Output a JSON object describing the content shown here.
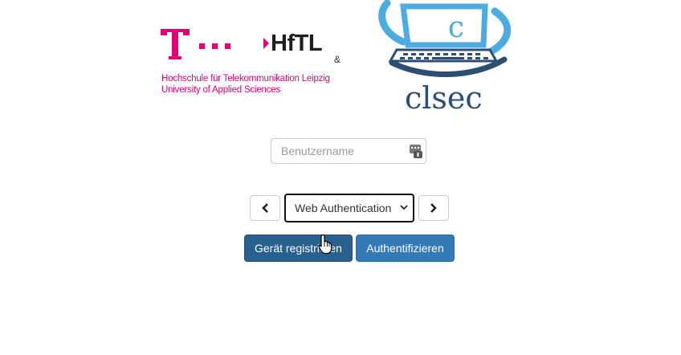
{
  "logos": {
    "hftl": {
      "name": "HfTL",
      "line1": "Hochschule für Telekommunikation Leipzig",
      "line2": "University of Applied Sciences"
    },
    "ampersand": "&",
    "clsec": {
      "letter": "c",
      "name": "clsec"
    }
  },
  "login": {
    "username_placeholder": "Benutzername",
    "username_value": ""
  },
  "method": {
    "selected": "Web Authentication",
    "options": [
      "Web Authentication"
    ]
  },
  "actions": {
    "register_label": "Gerät registrieren",
    "authenticate_label": "Authentifizieren"
  },
  "colors": {
    "telekom_magenta": "#e20074",
    "clsec_light_blue": "#4aace0",
    "clsec_dark_blue": "#2d4e73",
    "btn_primary": "#337ab7",
    "btn_primary_active": "#286090"
  },
  "icons": {
    "username_addon": "keypad-icon",
    "prev": "chevron-left-icon",
    "next": "chevron-right-icon",
    "select": "chevron-down-icon",
    "pointer": "hand-cursor-icon"
  }
}
